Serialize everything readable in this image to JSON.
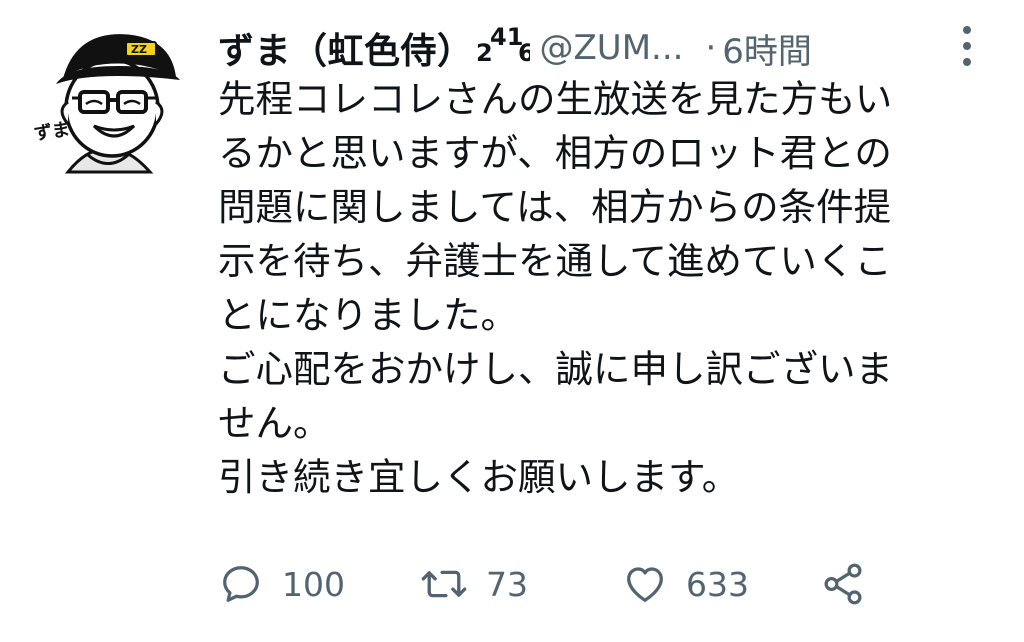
{
  "tweet": {
    "display_name": "ずま（虹色侍）",
    "name_suffix": "2416",
    "handle": "@ZUM...",
    "separator": "·",
    "time": "6時間",
    "text_lines": [
      "先程コレコレさんの生放送を見た方もい",
      "るかと思いますが、相方のロット君との",
      "問題に関しましては、相方からの条件提",
      "示を待ち、弁護士を通して進めていくこ",
      "とになりました。",
      "ご心配をおかけし、誠に申し訳ございま",
      "せん。",
      "引き続き宜しくお願いします。"
    ],
    "avatar_caption": "ずま",
    "avatar_cap_text": "ZZ"
  },
  "actions": {
    "reply_count": "100",
    "retweet_count": "73",
    "like_count": "633"
  },
  "icons": {
    "reply": "reply-icon",
    "retweet": "retweet-icon",
    "like": "heart-icon",
    "share": "share-icon",
    "more": "more-options-icon"
  },
  "colors": {
    "text": "#0f1419",
    "muted": "#536471"
  }
}
